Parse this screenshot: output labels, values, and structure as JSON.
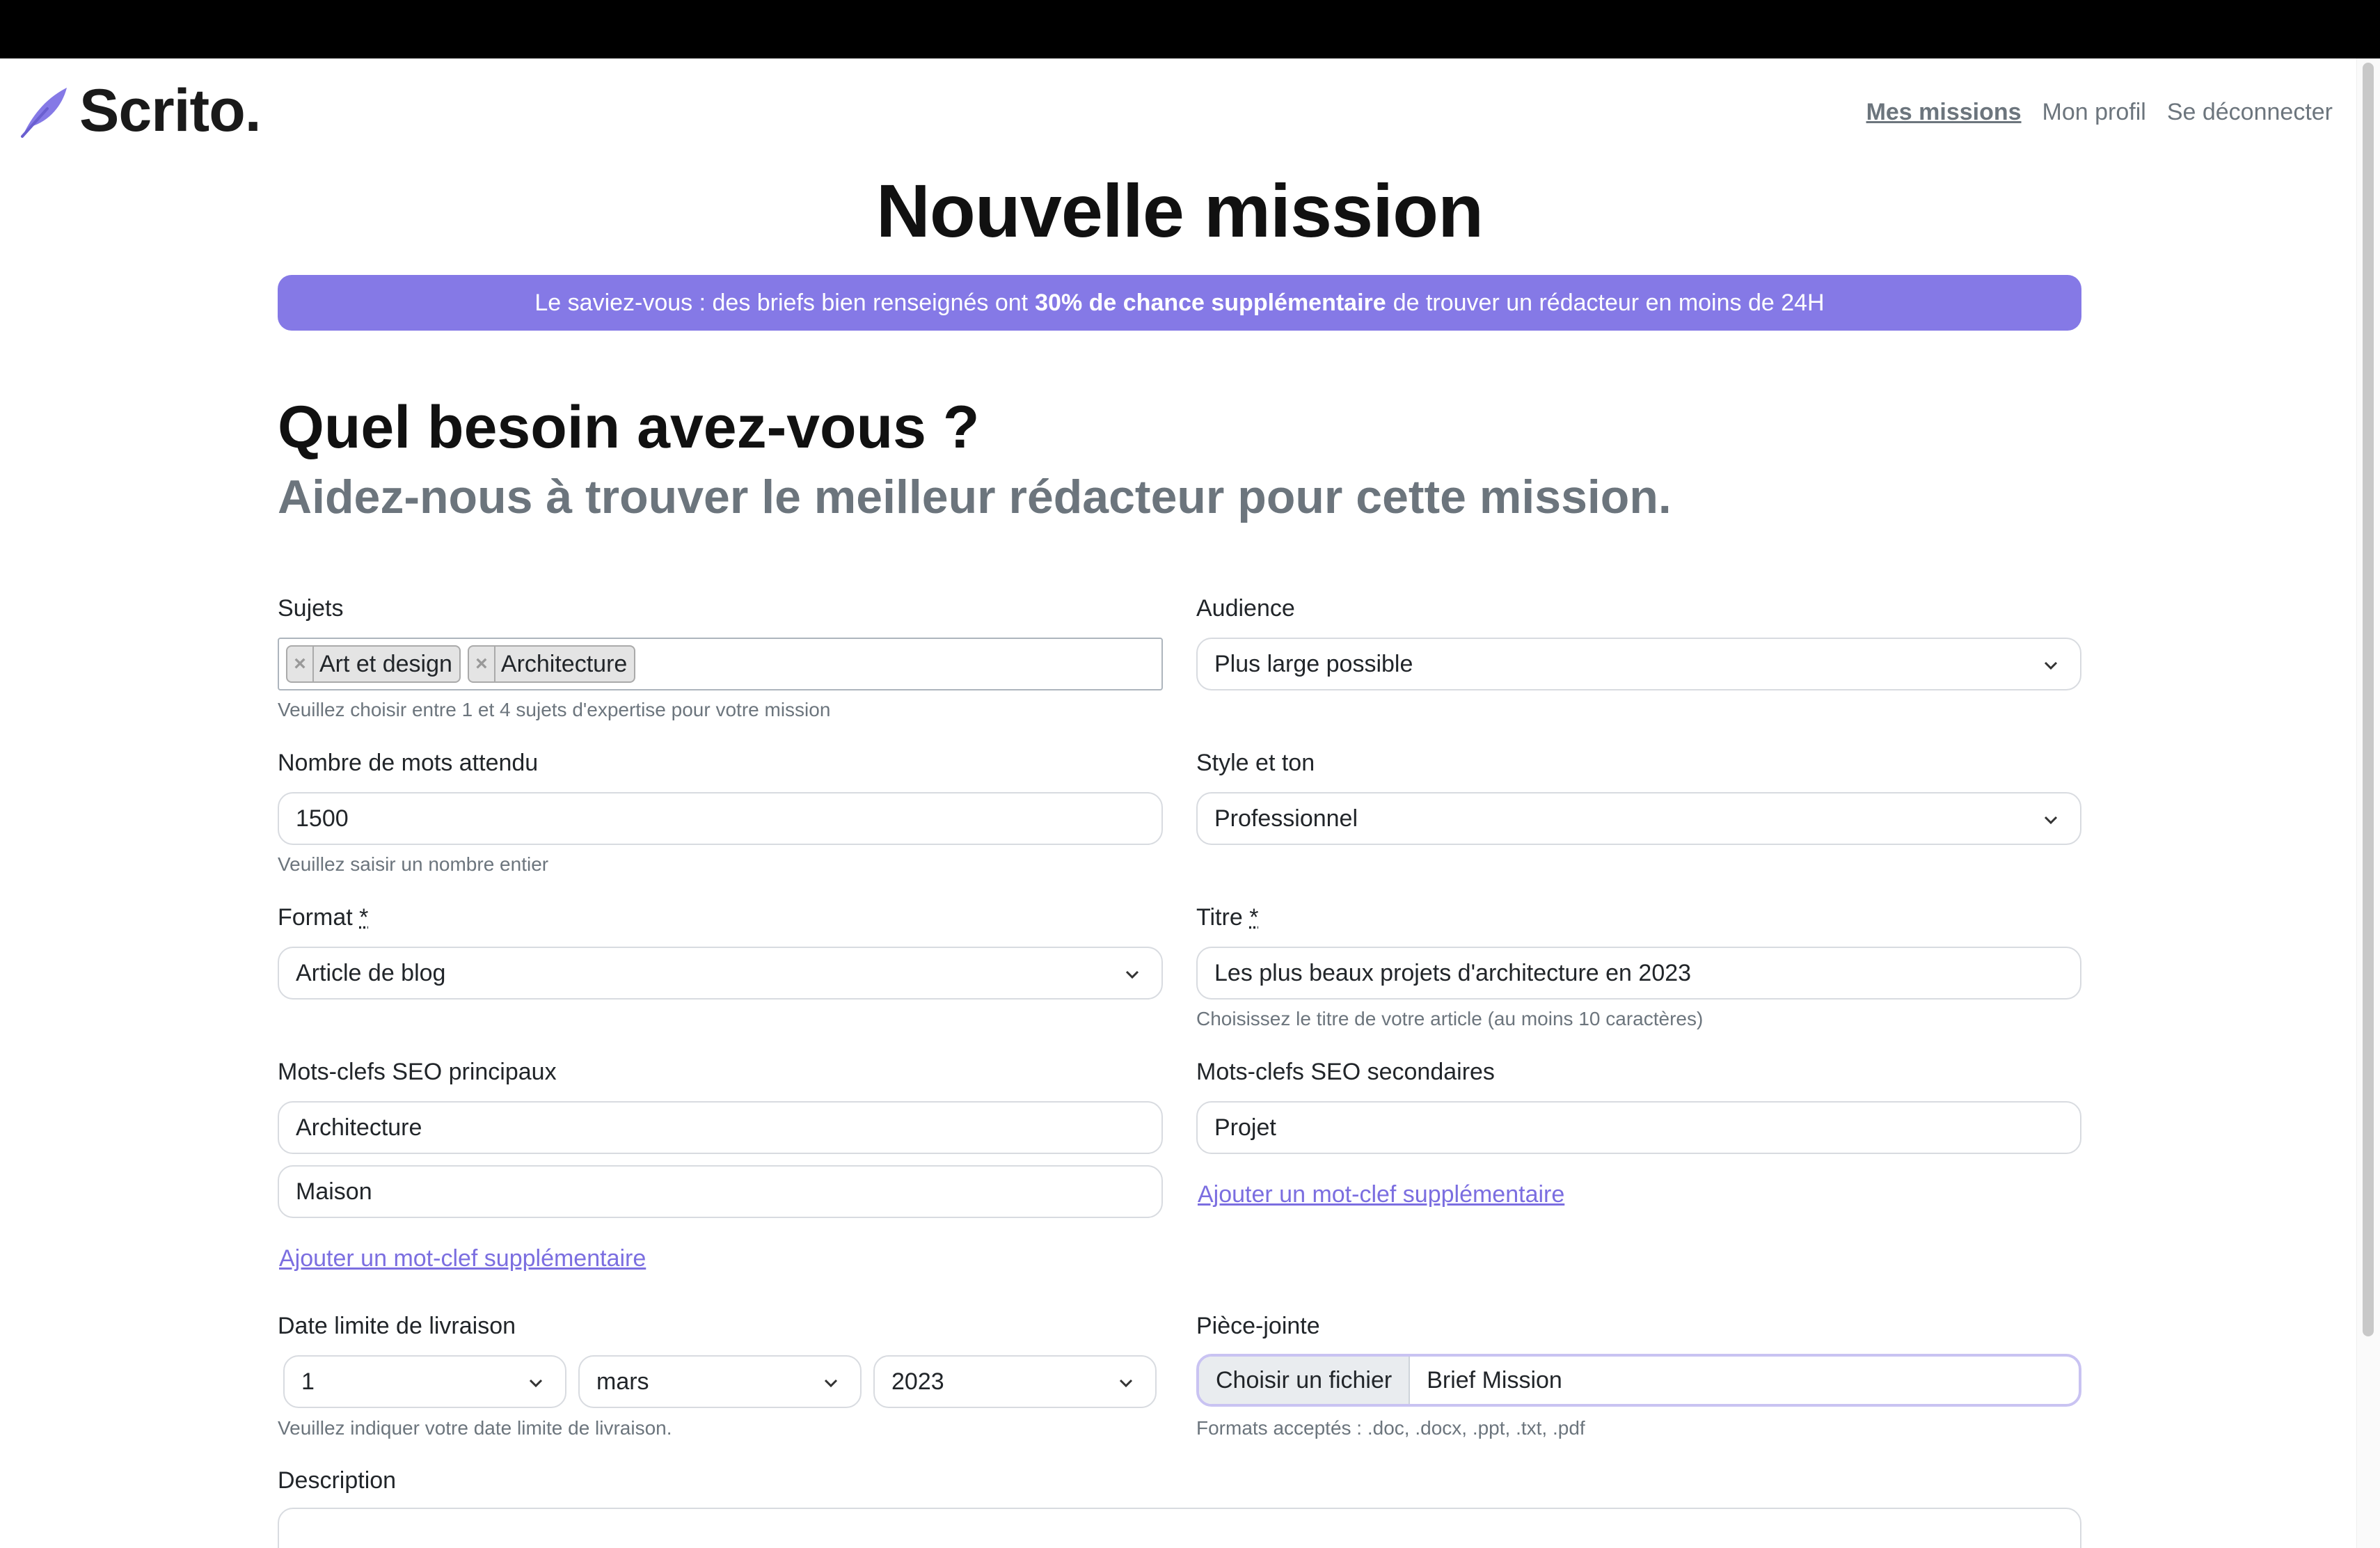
{
  "header": {
    "brand": "Scrito.",
    "nav": [
      "Mes missions",
      "Mon profil",
      "Se déconnecter"
    ]
  },
  "page": {
    "title": "Nouvelle mission",
    "banner": {
      "prefix": "Le saviez-vous : des briefs bien renseignés ont",
      "highlight": "30% de chance supplémentaire",
      "suffix": "de trouver un rédacteur en moins de 24H"
    },
    "heading": "Quel besoin avez-vous ?",
    "subheading": "Aidez-nous à trouver le meilleur rédacteur pour cette mission."
  },
  "form": {
    "sujets": {
      "label": "Sujets",
      "tags": [
        "Art et design",
        "Architecture"
      ],
      "help": "Veuillez choisir entre 1 et 4 sujets d'expertise pour votre mission"
    },
    "audience": {
      "label": "Audience",
      "value": "Plus large possible"
    },
    "mots": {
      "label": "Nombre de mots attendu",
      "value": "1500",
      "help": "Veuillez saisir un nombre entier"
    },
    "style": {
      "label": "Style et ton",
      "value": "Professionnel"
    },
    "format": {
      "label": "Format",
      "required": "*",
      "value": "Article de blog"
    },
    "titre": {
      "label": "Titre",
      "required": "*",
      "value": "Les plus beaux projets d'architecture en 2023",
      "help": "Choisissez le titre de votre article (au moins 10 caractères)"
    },
    "seo_principaux": {
      "label": "Mots-clefs SEO principaux",
      "values": [
        "Architecture",
        "Maison"
      ],
      "add_link": "Ajouter un mot-clef supplémentaire"
    },
    "seo_secondaires": {
      "label": "Mots-clefs SEO secondaires",
      "values": [
        "Projet"
      ],
      "add_link": "Ajouter un mot-clef supplémentaire"
    },
    "date": {
      "label": "Date limite de livraison",
      "day": "1",
      "month": "mars",
      "year": "2023",
      "help": "Veuillez indiquer votre date limite de livraison."
    },
    "piece_jointe": {
      "label": "Pièce-jointe",
      "button": "Choisir un fichier",
      "filename": "Brief Mission",
      "help": "Formats acceptés : .doc, .docx, .ppt, .txt, .pdf"
    },
    "description": {
      "label": "Description"
    }
  },
  "colors": {
    "accent": "#8579e6",
    "link": "#7b6ee0",
    "muted": "#6c757d"
  }
}
